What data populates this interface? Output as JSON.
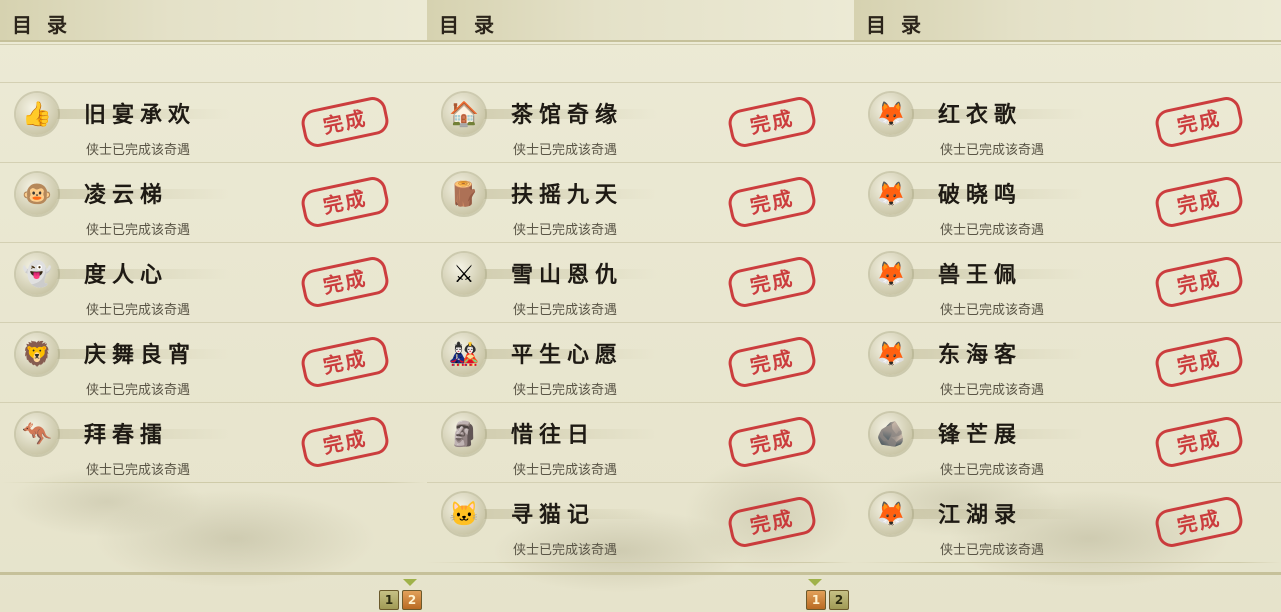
{
  "panels": [
    {
      "title": "目 录",
      "entries": [
        {
          "title": "旧宴承欢",
          "status": "侠士已完成该奇遇",
          "icon": "thumbs-up-icon",
          "glyph": "👍",
          "stamp": "完成"
        },
        {
          "title": "凌云梯",
          "status": "侠士已完成该奇遇",
          "icon": "mask-icon",
          "glyph": "🐵",
          "stamp": "完成"
        },
        {
          "title": "度人心",
          "status": "侠士已完成该奇遇",
          "icon": "ghost-icon",
          "glyph": "👻",
          "stamp": "完成"
        },
        {
          "title": "庆舞良宵",
          "status": "侠士已完成该奇遇",
          "icon": "lion-dance-icon",
          "glyph": "🦁",
          "stamp": "完成"
        },
        {
          "title": "拜春擂",
          "status": "侠士已完成该奇遇",
          "icon": "kangaroo-icon",
          "glyph": "🦘",
          "stamp": "完成"
        }
      ],
      "pages": [
        "1",
        "2"
      ],
      "active_page": "2"
    },
    {
      "title": "目 录",
      "entries": [
        {
          "title": "茶馆奇缘",
          "status": "侠士已完成该奇遇",
          "icon": "teahouse-icon",
          "glyph": "🏠",
          "stamp": "完成"
        },
        {
          "title": "扶摇九天",
          "status": "侠士已完成该奇遇",
          "icon": "wooden-post-icon",
          "glyph": "🪵",
          "stamp": "完成"
        },
        {
          "title": "雪山恩仇",
          "status": "侠士已完成该奇遇",
          "icon": "crossed-swords-icon",
          "glyph": "⚔",
          "stamp": "完成"
        },
        {
          "title": "平生心愿",
          "status": "侠士已完成该奇遇",
          "icon": "official-doll-icon",
          "glyph": "🎎",
          "stamp": "完成"
        },
        {
          "title": "惜往日",
          "status": "侠士已完成该奇遇",
          "icon": "golden-statue-icon",
          "glyph": "🗿",
          "stamp": "完成"
        },
        {
          "title": "寻猫记",
          "status": "侠士已完成该奇遇",
          "icon": "cat-icon",
          "glyph": "🐱",
          "stamp": "完成"
        }
      ],
      "pages": [
        "1",
        "2"
      ],
      "active_page": "1"
    },
    {
      "title": "目 录",
      "entries": [
        {
          "title": "红衣歌",
          "status": "侠士已完成该奇遇",
          "icon": "fox-icon",
          "glyph": "🦊",
          "stamp": "完成"
        },
        {
          "title": "破晓鸣",
          "status": "侠士已完成该奇遇",
          "icon": "fox-icon",
          "glyph": "🦊",
          "stamp": "完成"
        },
        {
          "title": "兽王佩",
          "status": "侠士已完成该奇遇",
          "icon": "fox-icon",
          "glyph": "🦊",
          "stamp": "完成"
        },
        {
          "title": "东海客",
          "status": "侠士已完成该奇遇",
          "icon": "fox-icon",
          "glyph": "🦊",
          "stamp": "完成"
        },
        {
          "title": "锋芒展",
          "status": "侠士已完成该奇遇",
          "icon": "green-orb-icon",
          "glyph": "🪨",
          "stamp": "完成"
        },
        {
          "title": "江湖录",
          "status": "侠士已完成该奇遇",
          "icon": "fox-icon",
          "glyph": "🦊",
          "stamp": "完成"
        }
      ],
      "pages": [],
      "active_page": ""
    }
  ]
}
